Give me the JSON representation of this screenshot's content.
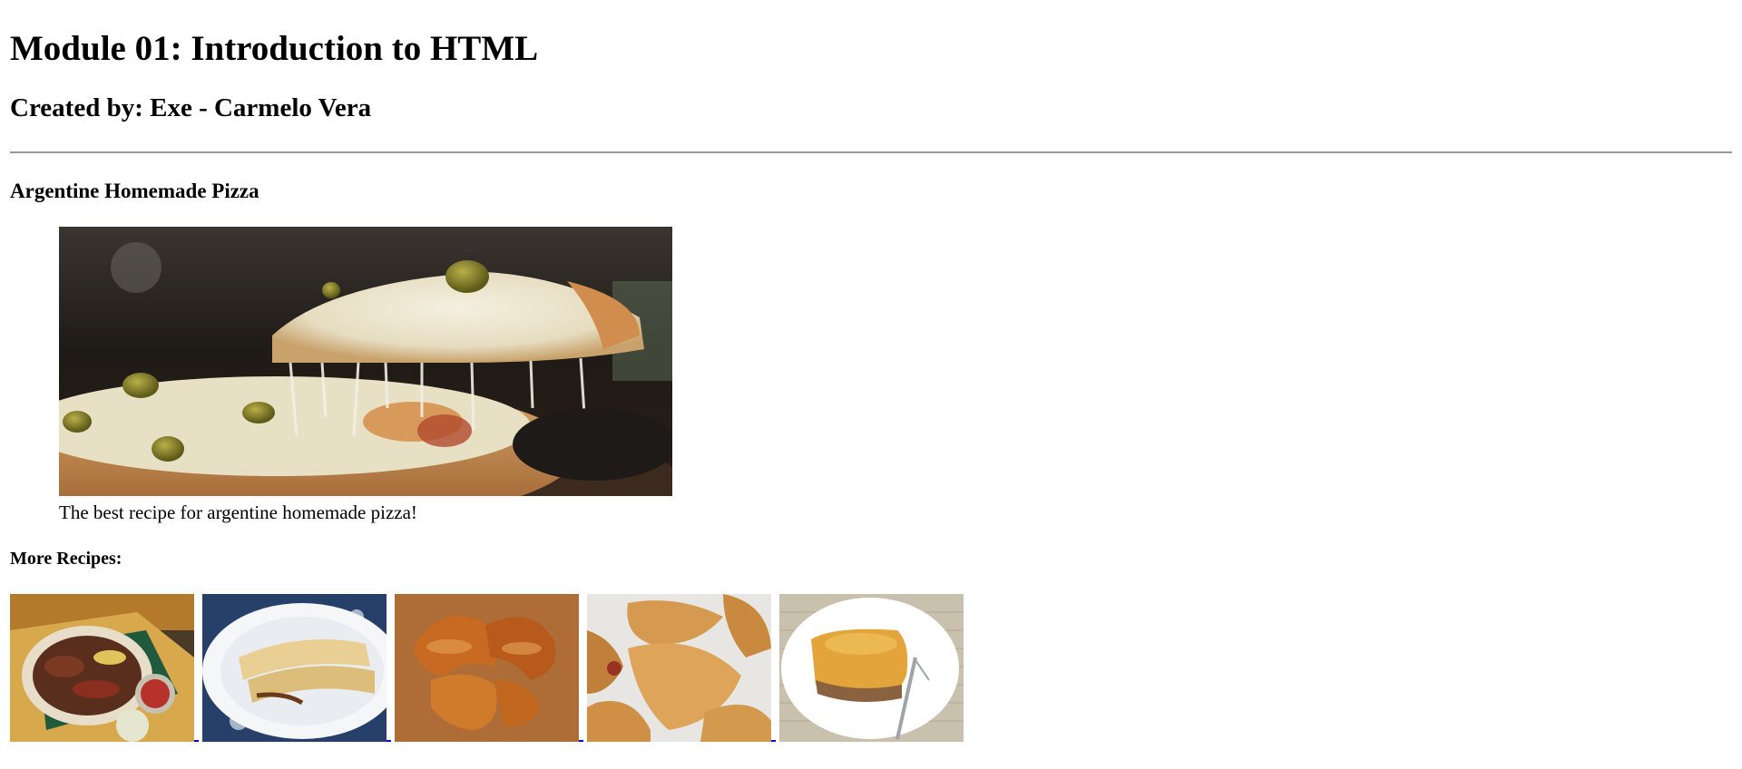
{
  "header": {
    "title": "Module 01: Introduction to HTML",
    "author": "Created by: Exe - Carmelo Vera"
  },
  "recipe": {
    "heading": "Argentine Homemade Pizza",
    "image_icon": "pizza-photo",
    "caption": "The best recipe for argentine homemade pizza!"
  },
  "more_recipes": {
    "heading": "More Recipes:",
    "items": [
      {
        "icon": "asado-photo"
      },
      {
        "icon": "crepes-photo"
      },
      {
        "icon": "croissants-photo"
      },
      {
        "icon": "empanadas-photo"
      },
      {
        "icon": "pastel-de-papa-photo"
      }
    ]
  },
  "colors": {
    "link": "#0000ee",
    "divider": "#9a9a9a"
  }
}
